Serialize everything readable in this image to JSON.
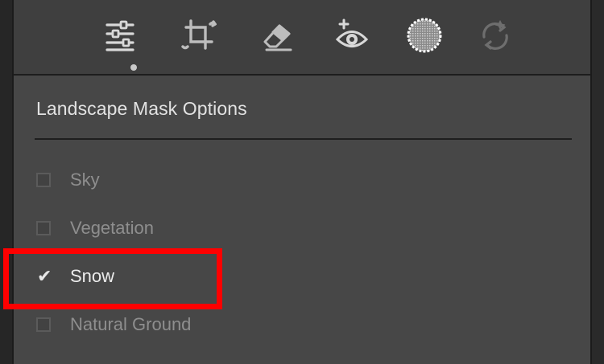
{
  "toolbar": {
    "tools": [
      {
        "icon": "sliders-icon",
        "active": true
      },
      {
        "icon": "crop-rotate-icon",
        "active": false
      },
      {
        "icon": "eraser-icon",
        "active": false
      },
      {
        "icon": "red-eye-icon",
        "active": false
      },
      {
        "icon": "masking-icon",
        "active": false
      },
      {
        "icon": "presets-refresh-icon",
        "active": false
      }
    ]
  },
  "panel": {
    "title": "Landscape Mask Options",
    "options": [
      {
        "label": "Sky",
        "checked": false
      },
      {
        "label": "Vegetation",
        "checked": false
      },
      {
        "label": "Snow",
        "checked": true
      },
      {
        "label": "Natural Ground",
        "checked": false
      }
    ]
  },
  "colors": {
    "panel_bg": "#474747",
    "toolbar_bg": "#3f3f3f",
    "highlight": "#ff0000",
    "text_active": "#ececec",
    "text_muted": "#8e8e8e"
  }
}
